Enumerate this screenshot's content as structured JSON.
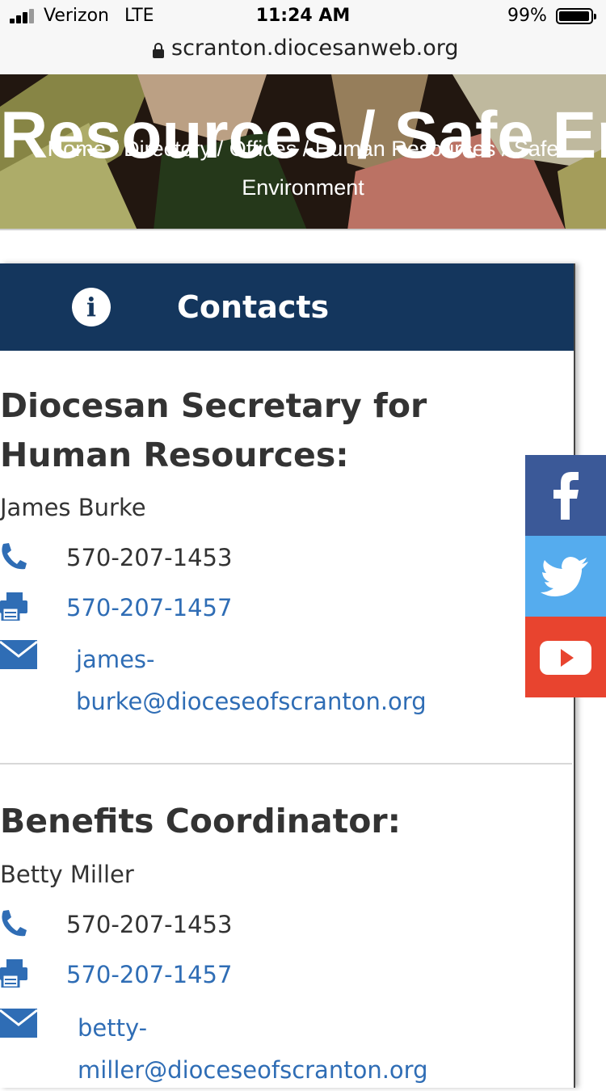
{
  "status_bar": {
    "carrier": "Verizon",
    "network": "LTE",
    "time": "11:24 AM",
    "battery": "99%"
  },
  "browser": {
    "url": "scranton.diocesanweb.org"
  },
  "hero": {
    "title": "Resources / Safe Environment",
    "breadcrumb": [
      "Home",
      "Directory",
      "Offices",
      "Human Resources",
      "Safe Environment"
    ]
  },
  "contacts_card": {
    "title": "Contacts",
    "contacts": [
      {
        "role": "Diocesan Secretary for Human Resources:",
        "name": "James Burke",
        "phone": "570-207-1453",
        "fax": "570-207-1457",
        "email_line1": "james-",
        "email_line2": "burke@dioceseofscranton.org"
      },
      {
        "role": "Benefits Coordinator:",
        "name": "Betty Miller",
        "phone": "570-207-1453",
        "fax": "570-207-1457",
        "email_line1": "betty-",
        "email_line2": "miller@dioceseofscranton.org"
      }
    ]
  },
  "social": {
    "icons": [
      "facebook-icon",
      "twitter-icon",
      "youtube-icon"
    ],
    "colors": {
      "facebook": "#3b5998",
      "twitter": "#55acee",
      "youtube": "#e8442f"
    }
  },
  "colors": {
    "header_bg": "#14365d",
    "link": "#2f6db5"
  }
}
